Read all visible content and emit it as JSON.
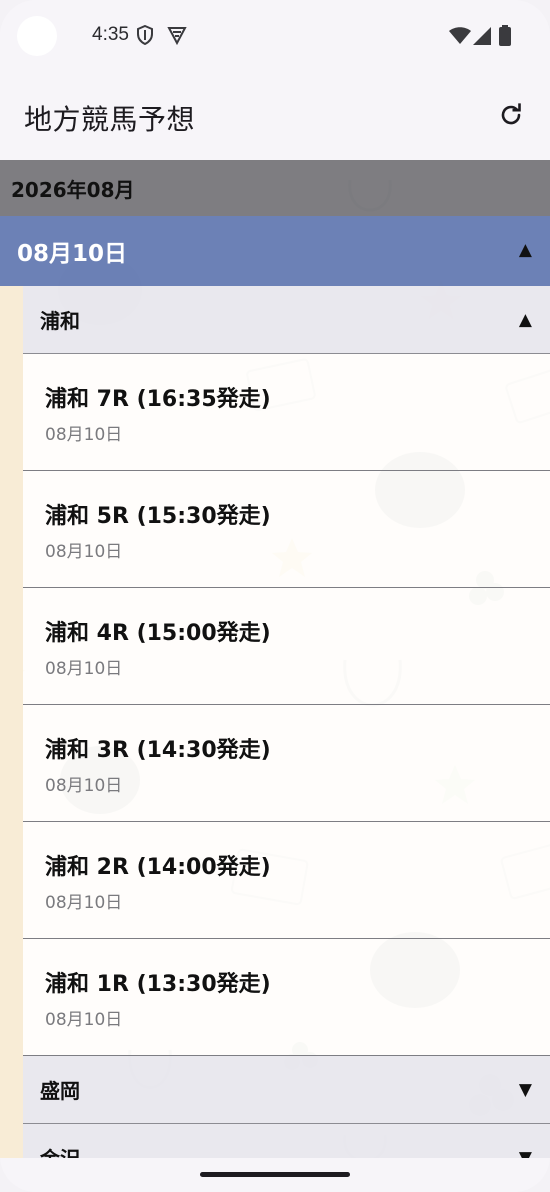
{
  "status_bar": {
    "time": "4:35",
    "icons": [
      "shield-icon",
      "vpn-icon",
      "wifi-icon",
      "signal-icon",
      "battery-icon"
    ]
  },
  "app_bar": {
    "title": "地方競馬予想",
    "refresh_icon": "refresh-icon"
  },
  "month_header": "2026年08月",
  "date_group": {
    "label": "08月10日",
    "expanded": true
  },
  "venues": [
    {
      "name": "浦和",
      "expanded": true,
      "races": [
        {
          "title": "浦和 7R (16:35発走)",
          "date": "08月10日"
        },
        {
          "title": "浦和 5R (15:30発走)",
          "date": "08月10日"
        },
        {
          "title": "浦和 4R (15:00発走)",
          "date": "08月10日"
        },
        {
          "title": "浦和 3R (14:30発走)",
          "date": "08月10日"
        },
        {
          "title": "浦和 2R (14:00発走)",
          "date": "08月10日"
        },
        {
          "title": "浦和 1R (13:30発走)",
          "date": "08月10日"
        }
      ]
    },
    {
      "name": "盛岡",
      "expanded": false
    },
    {
      "name": "金沢",
      "expanded": false
    }
  ],
  "colors": {
    "month_header_bg": "#707076",
    "date_header_bg": "#677DB4",
    "venue_header_bg": "#E8E7EE",
    "background": "#FBF3E6"
  }
}
